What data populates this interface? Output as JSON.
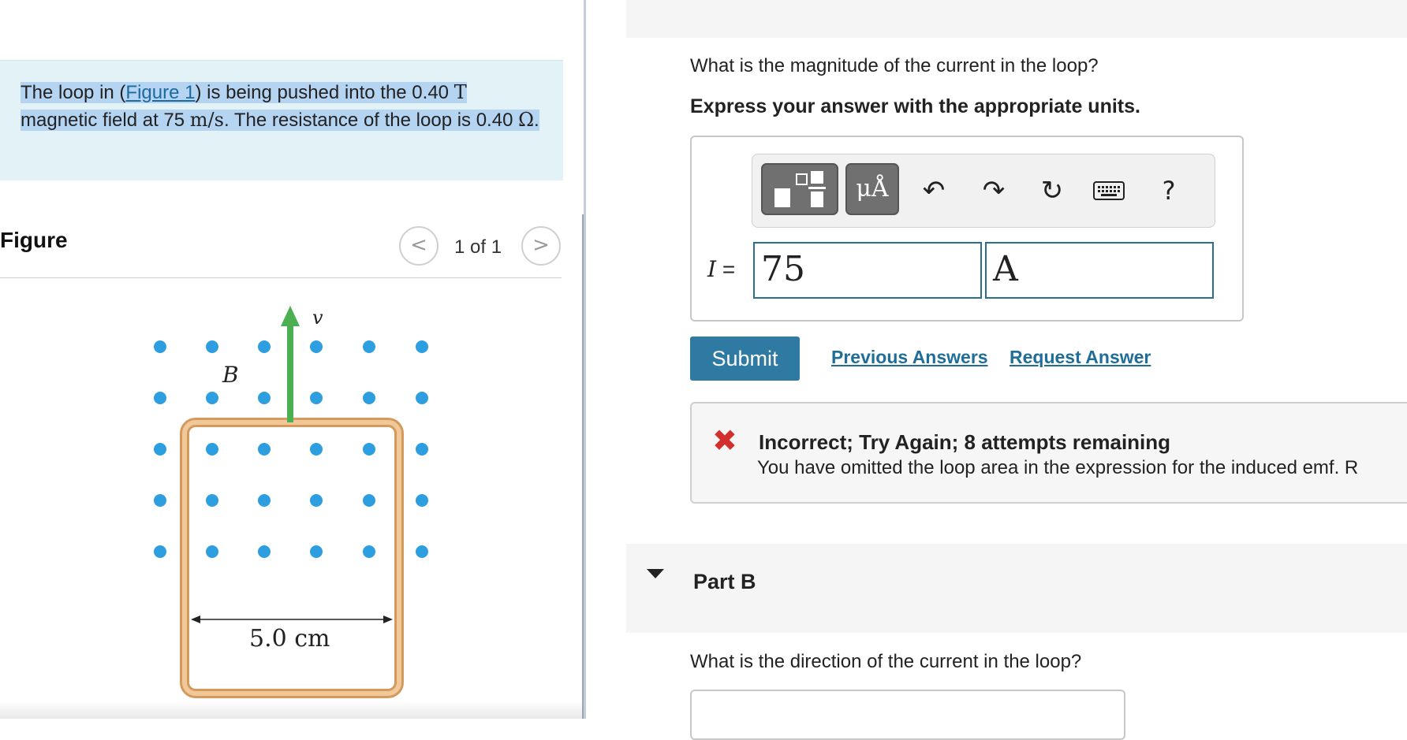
{
  "problem": {
    "prefix": "The loop in (",
    "figure_link": "Figure 1",
    "middle1": ") is being pushed into the 0.40 ",
    "unit_T": "T",
    "middle2": " magnetic field at 75 ",
    "unit_mps": "m/s",
    "middle3": ". The resistance of the loop is 0.40 ",
    "unit_ohm": "Ω",
    "suffix": "."
  },
  "figure_panel": {
    "title": "Figure",
    "prev_icon": "chevron-left-icon",
    "next_icon": "chevron-right-icon",
    "prev_glyph": "<",
    "next_glyph": ">",
    "page_indicator": "1 of 1"
  },
  "figure": {
    "velocity_label": "v",
    "field_label": "B",
    "width_label": "5.0 cm",
    "colors": {
      "dots": "#2d9ee0",
      "arrow": "#4caf50",
      "loop": "#e2b27d"
    }
  },
  "part_a": {
    "question": "What is the magnitude of the current in the loop?",
    "instruction": "Express your answer with the appropriate units.",
    "toolbar": {
      "units_label": "μÅ",
      "undo_glyph": "↶",
      "redo_glyph": "↷",
      "reset_glyph": "↻",
      "help_label": "?"
    },
    "variable_symbol": "I",
    "equals": "=",
    "value": "75",
    "unit": "A",
    "submit_label": "Submit",
    "previous_answers_label": "Previous Answers",
    "request_answer_label": "Request Answer",
    "feedback": {
      "title": "Incorrect; Try Again; 8 attempts remaining",
      "body": "You have omitted the loop area in the expression for the induced emf. R"
    }
  },
  "part_b": {
    "title": "Part B",
    "question": "What is the direction of the current in the loop?"
  }
}
